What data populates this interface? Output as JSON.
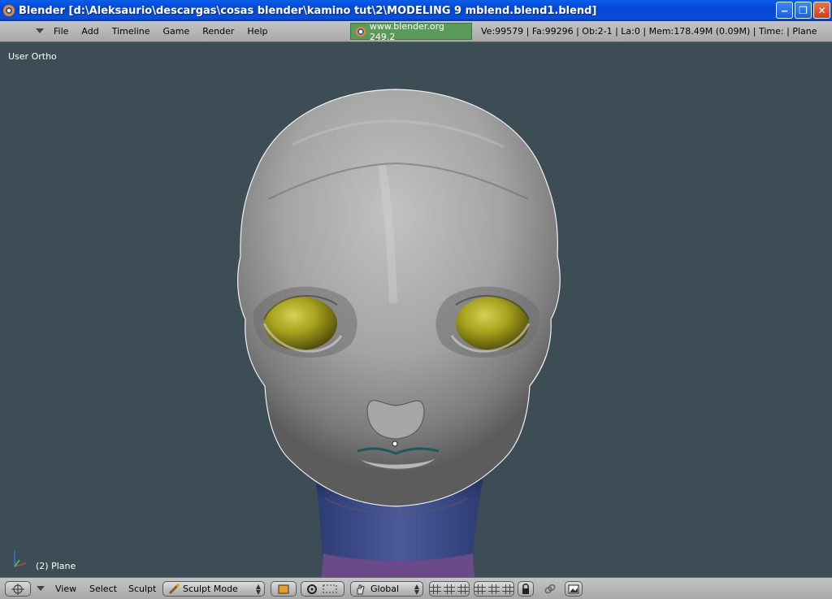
{
  "window": {
    "title": "Blender [d:\\Aleksaurio\\descargas\\cosas blender\\kamino tut\\2\\MODELING 9 mblend.blend1.blend]",
    "minimize_glyph": "‒",
    "restore_glyph": "❐",
    "close_glyph": "✕"
  },
  "top_header": {
    "menus": [
      "File",
      "Add",
      "Timeline",
      "Game",
      "Render",
      "Help"
    ],
    "splash": "www.blender.org 249.2",
    "stats": "Ve:99579 | Fa:99296 | Ob:2-1 | La:0  | Mem:178.49M (0.09M)  | Time: | Plane"
  },
  "viewport": {
    "view_name": "User Ortho",
    "object_info": "(2) Plane",
    "background_color": "#3c4d55"
  },
  "bottom_header": {
    "menus": [
      "View",
      "Select",
      "Sculpt"
    ],
    "mode": "Sculpt Mode",
    "orientation": "Global"
  },
  "colors": {
    "skin": "#9a9a9a",
    "eye": "#a8a21c",
    "neck_blue": "#3c4a86",
    "neck_purple": "#6a4a88"
  }
}
